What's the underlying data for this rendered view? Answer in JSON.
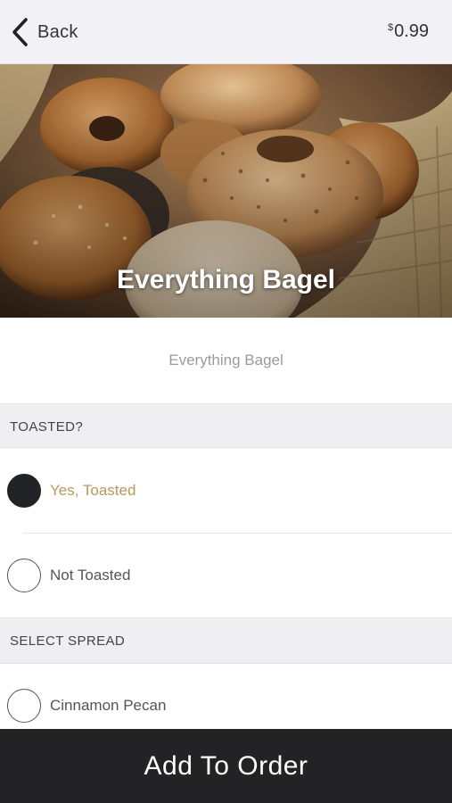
{
  "header": {
    "back_label": "Back",
    "price_currency": "$",
    "price_amount": "0.99"
  },
  "hero": {
    "title": "Everything Bagel"
  },
  "description": "Everything Bagel",
  "toasted_section": {
    "title": "TOASTED?",
    "options": [
      {
        "label": "Yes, Toasted",
        "selected": true
      },
      {
        "label": "Not Toasted",
        "selected": false
      }
    ]
  },
  "spread_section": {
    "title": "SELECT SPREAD",
    "options": [
      {
        "label": "Cinnamon Pecan",
        "selected": false
      }
    ]
  },
  "footer": {
    "add_label": "Add To Order"
  },
  "colors": {
    "accent": "#b49a5e",
    "dark": "#232325",
    "section_bg": "#efeff2"
  },
  "icons": {
    "back": "chevron-left-icon",
    "hero": "bagel-basket-photo"
  }
}
